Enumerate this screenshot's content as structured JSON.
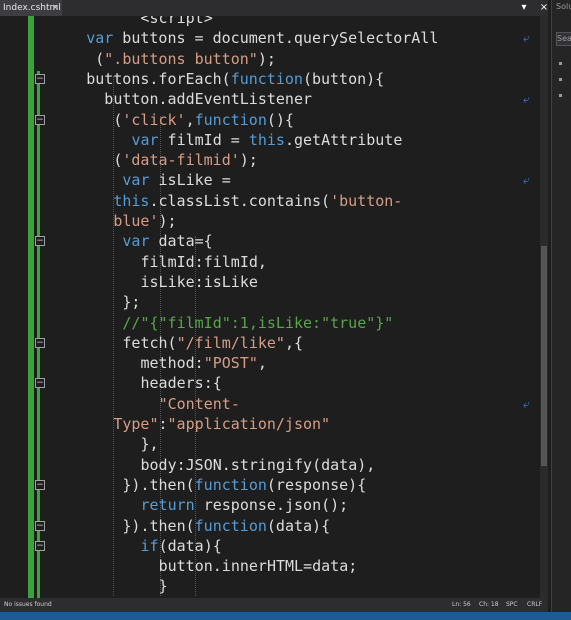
{
  "tab": {
    "title": "Index.cshtml",
    "close": "×"
  },
  "window_buttons": {
    "pin": "▾",
    "close": "×"
  },
  "right_panel": {
    "title": "Solu",
    "search": "Sear"
  },
  "code_lines": [
    {
      "indent": 10,
      "tokens": [
        {
          "t": "<script>",
          "c": "pl"
        }
      ]
    },
    {
      "indent": 4,
      "tokens": [
        {
          "t": "var",
          "c": "kw"
        },
        {
          "t": " buttons = document.querySelectorAll",
          "c": "pl"
        }
      ],
      "wrap": true
    },
    {
      "indent": 5,
      "tokens": [
        {
          "t": "(",
          "c": "pl"
        },
        {
          "t": "\".buttons button\"",
          "c": "str"
        },
        {
          "t": ");",
          "c": "pl"
        }
      ]
    },
    {
      "indent": 4,
      "tokens": [
        {
          "t": "buttons.forEach(",
          "c": "pl"
        },
        {
          "t": "function",
          "c": "kw"
        },
        {
          "t": "(button){",
          "c": "pl"
        }
      ]
    },
    {
      "indent": 6,
      "tokens": [
        {
          "t": "button.addEventListener",
          "c": "pl"
        }
      ],
      "wrap": true
    },
    {
      "indent": 7,
      "tokens": [
        {
          "t": "(",
          "c": "pl"
        },
        {
          "t": "'click'",
          "c": "str"
        },
        {
          "t": ",",
          "c": "pl"
        },
        {
          "t": "function",
          "c": "kw"
        },
        {
          "t": "(){",
          "c": "pl"
        }
      ]
    },
    {
      "indent": 9,
      "tokens": [
        {
          "t": "var",
          "c": "kw"
        },
        {
          "t": " filmId = ",
          "c": "pl"
        },
        {
          "t": "this",
          "c": "kw"
        },
        {
          "t": ".getAttribute",
          "c": "pl"
        }
      ]
    },
    {
      "indent": 7,
      "tokens": [
        {
          "t": "(",
          "c": "pl"
        },
        {
          "t": "'data-filmid'",
          "c": "str"
        },
        {
          "t": ");",
          "c": "pl"
        }
      ]
    },
    {
      "indent": 8,
      "tokens": [
        {
          "t": "var",
          "c": "kw"
        },
        {
          "t": " isLike =",
          "c": "pl"
        }
      ],
      "wrap": true
    },
    {
      "indent": 7,
      "tokens": [
        {
          "t": "this",
          "c": "kw"
        },
        {
          "t": ".classList.contains(",
          "c": "pl"
        },
        {
          "t": "'button-",
          "c": "str"
        }
      ]
    },
    {
      "indent": 7,
      "tokens": [
        {
          "t": "blue'",
          "c": "str"
        },
        {
          "t": ");",
          "c": "pl"
        }
      ]
    },
    {
      "indent": 8,
      "tokens": [
        {
          "t": "var",
          "c": "kw"
        },
        {
          "t": " data={",
          "c": "pl"
        }
      ]
    },
    {
      "indent": 10,
      "tokens": [
        {
          "t": "filmId:filmId,",
          "c": "pl"
        }
      ]
    },
    {
      "indent": 10,
      "tokens": [
        {
          "t": "isLike:isLike",
          "c": "pl"
        }
      ]
    },
    {
      "indent": 8,
      "tokens": [
        {
          "t": "};",
          "c": "pl"
        }
      ]
    },
    {
      "indent": 8,
      "tokens": [
        {
          "t": "//\"{\"filmId\":1,isLike:\"true\"}\"",
          "c": "cm"
        }
      ]
    },
    {
      "indent": 8,
      "tokens": [
        {
          "t": "fetch(",
          "c": "pl"
        },
        {
          "t": "\"/film/like\"",
          "c": "str"
        },
        {
          "t": ",{",
          "c": "pl"
        }
      ]
    },
    {
      "indent": 10,
      "tokens": [
        {
          "t": "method:",
          "c": "pl"
        },
        {
          "t": "\"POST\"",
          "c": "str"
        },
        {
          "t": ",",
          "c": "pl"
        }
      ]
    },
    {
      "indent": 10,
      "tokens": [
        {
          "t": "headers:{",
          "c": "pl"
        }
      ]
    },
    {
      "indent": 12,
      "tokens": [
        {
          "t": "\"Content-",
          "c": "str"
        }
      ],
      "wrap": true
    },
    {
      "indent": 7,
      "tokens": [
        {
          "t": "Type\"",
          "c": "str"
        },
        {
          "t": ":",
          "c": "pl"
        },
        {
          "t": "\"application/json\"",
          "c": "str"
        }
      ]
    },
    {
      "indent": 10,
      "tokens": [
        {
          "t": "},",
          "c": "pl"
        }
      ]
    },
    {
      "indent": 10,
      "tokens": [
        {
          "t": "body:JSON.stringify(data),",
          "c": "pl"
        }
      ]
    },
    {
      "indent": 8,
      "tokens": [
        {
          "t": "}).then(",
          "c": "pl"
        },
        {
          "t": "function",
          "c": "kw"
        },
        {
          "t": "(response){",
          "c": "pl"
        }
      ]
    },
    {
      "indent": 10,
      "tokens": [
        {
          "t": "return",
          "c": "kw"
        },
        {
          "t": " response.json();",
          "c": "pl"
        }
      ]
    },
    {
      "indent": 8,
      "tokens": [
        {
          "t": "}).then(",
          "c": "pl"
        },
        {
          "t": "function",
          "c": "kw"
        },
        {
          "t": "(data){",
          "c": "pl"
        }
      ]
    },
    {
      "indent": 10,
      "tokens": [
        {
          "t": "if",
          "c": "kw"
        },
        {
          "t": "(data){",
          "c": "pl"
        }
      ]
    },
    {
      "indent": 12,
      "tokens": [
        {
          "t": "button.innerHTML=data;",
          "c": "pl"
        }
      ]
    },
    {
      "indent": 12,
      "tokens": [
        {
          "t": "}",
          "c": "pl"
        }
      ]
    },
    {
      "indent": 10,
      "tokens": [
        {
          "t": "});",
          "c": "pl"
        }
      ]
    }
  ],
  "status_bar": {
    "issues": "No issues found",
    "line": "Ln: 56",
    "col": "Ch: 18",
    "spc": "SPC",
    "crlf": "CRLF"
  },
  "colors": {
    "background": "#1e1e1e",
    "keyword": "#569cd6",
    "string": "#d69d85",
    "comment": "#57a64a",
    "plain": "#dcdcdc",
    "change_bar": "#3ca33c"
  }
}
